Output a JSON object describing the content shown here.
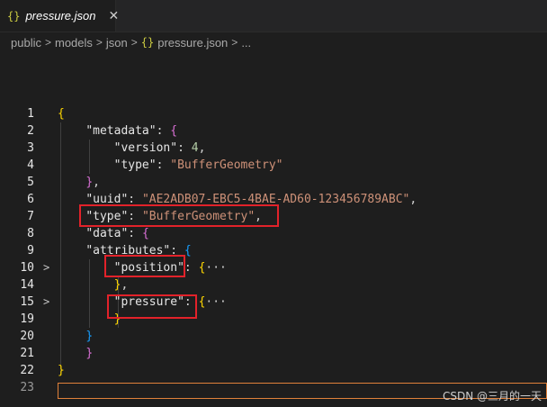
{
  "tab": {
    "icon": "json-braces-icon",
    "icon_glyph": "{}",
    "title": "pressure.json",
    "close_glyph": "✕"
  },
  "breadcrumb": {
    "items": [
      "public",
      "models",
      "json"
    ],
    "file_icon_glyph": "{}",
    "file": "pressure.json",
    "more": "..."
  },
  "line_numbers": [
    "1",
    "2",
    "3",
    "4",
    "5",
    "6",
    "7",
    "8",
    "9",
    "10",
    "14",
    "15",
    "19",
    "20",
    "21",
    "22",
    "23"
  ],
  "code": {
    "l1_open": "{",
    "metadata_key": "\"metadata\"",
    "version_key": "\"version\"",
    "version_val": "4",
    "type_key": "\"type\"",
    "type_val": "\"BufferGeometry\"",
    "uuid_key": "\"uuid\"",
    "uuid_val": "\"AE2ADB07-EBC5-4BAE-AD60-123456789ABC\"",
    "data_key": "\"data\"",
    "attributes_key": "\"attributes\"",
    "position_key": "\"position\"",
    "pressure_key": "\"pressure\"",
    "folded": "···"
  },
  "watermark": "CSDN @三月的一天",
  "colors": {
    "highlight_box": "#e2222a",
    "current_line_border": "#e0813a"
  }
}
